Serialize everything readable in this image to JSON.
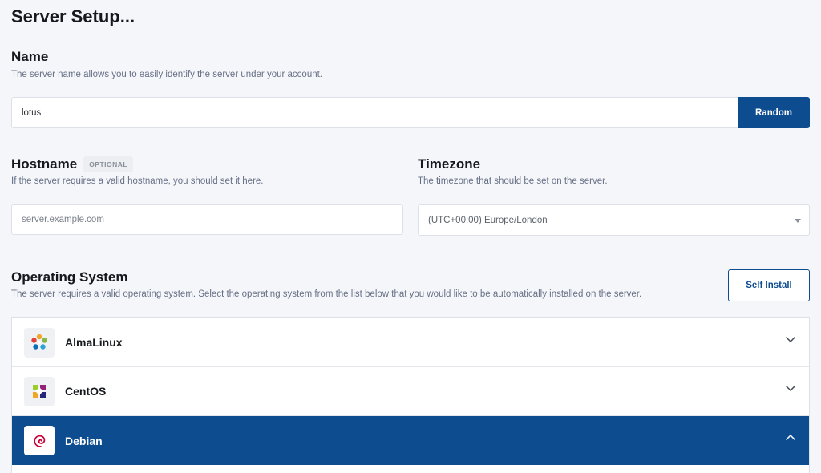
{
  "page": {
    "title": "Server Setup..."
  },
  "name_section": {
    "title": "Name",
    "description": "The server name allows you to easily identify the server under your account.",
    "value": "lotus",
    "random_label": "Random"
  },
  "hostname_section": {
    "title": "Hostname",
    "badge": "OPTIONAL",
    "description": "If the server requires a valid hostname, you should set it here.",
    "placeholder": "server.example.com"
  },
  "timezone_section": {
    "title": "Timezone",
    "description": "The timezone that should be set on the server.",
    "selected": "(UTC+00:00) Europe/London"
  },
  "os_section": {
    "title": "Operating System",
    "description": "The server requires a valid operating system. Select the operating system from the list below that you would like to be automatically installed on the server.",
    "self_install_label": "Self Install",
    "items": [
      {
        "label": "AlmaLinux",
        "icon": "almalinux-logo-icon",
        "expanded": false
      },
      {
        "label": "CentOS",
        "icon": "centos-logo-icon",
        "expanded": false
      },
      {
        "label": "Debian",
        "icon": "debian-logo-icon",
        "expanded": true
      }
    ]
  },
  "colors": {
    "accent": "#0d4c8f",
    "background": "#f5f6fa"
  }
}
